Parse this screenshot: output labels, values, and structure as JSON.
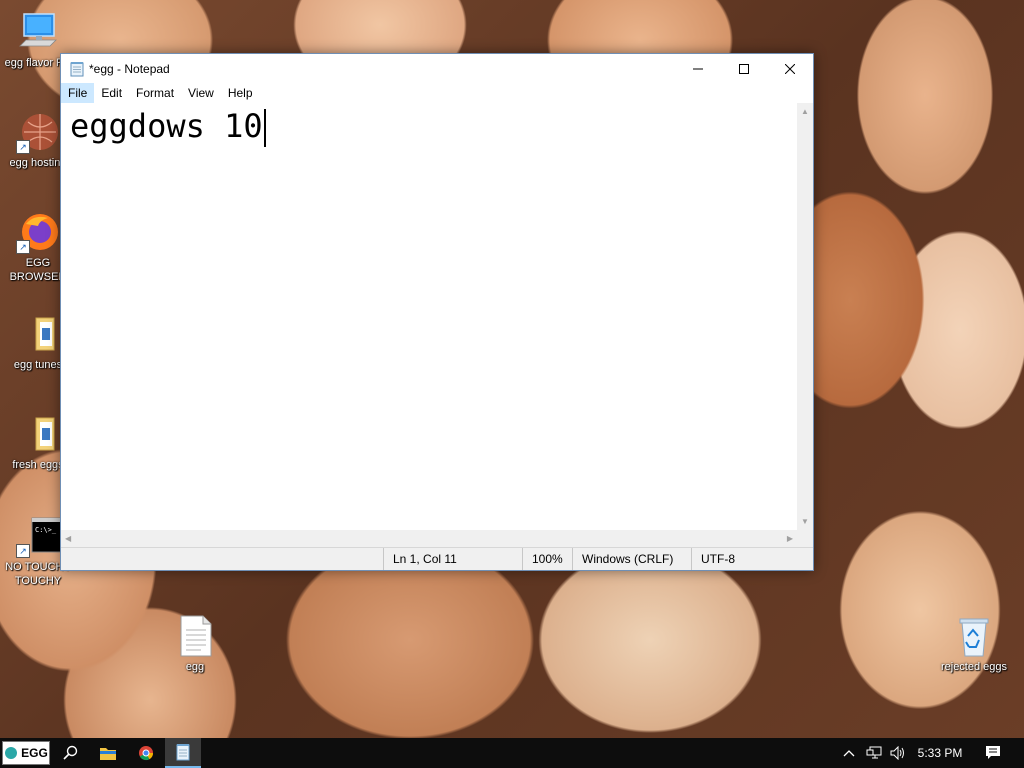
{
  "desktop": {
    "icons": [
      {
        "label": "egg flavor PC"
      },
      {
        "label": "egg hosting"
      },
      {
        "label": "EGG BROWSER"
      },
      {
        "label": "egg tunes"
      },
      {
        "label": "fresh eggs"
      },
      {
        "label": "NO TOUCHY TOUCHY"
      },
      {
        "label": "egg"
      },
      {
        "label": "rejected eggs"
      }
    ]
  },
  "notepad": {
    "title": "*egg - Notepad",
    "menu": [
      "File",
      "Edit",
      "Format",
      "View",
      "Help"
    ],
    "content": "eggdows 10",
    "status": {
      "position": "Ln 1, Col 11",
      "zoom": "100%",
      "line_ending": "Windows (CRLF)",
      "encoding": "UTF-8"
    }
  },
  "taskbar": {
    "start_label": "EGG",
    "clock": "5:33 PM"
  }
}
